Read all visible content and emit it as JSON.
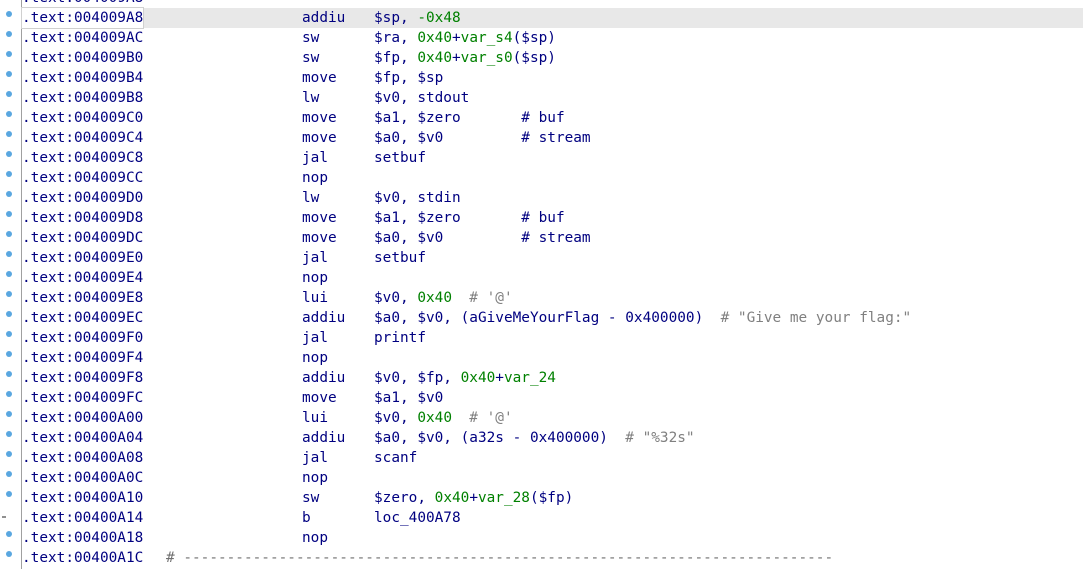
{
  "listing": {
    "partial_top_row": ".text:004009A8",
    "separator_comment": "# ---------------------------------------------------------------------------",
    "rows": [
      {
        "addr": ".text:004009A8",
        "mnem": "addiu",
        "ops": [
          {
            "t": "$sp, ",
            "c": "op"
          },
          {
            "t": "-0x48",
            "c": "num"
          }
        ],
        "selected": true
      },
      {
        "addr": ".text:004009AC",
        "mnem": "sw",
        "ops": [
          {
            "t": "$ra, ",
            "c": "op"
          },
          {
            "t": "0x40",
            "c": "num"
          },
          {
            "t": "+",
            "c": "op"
          },
          {
            "t": "var_s4",
            "c": "var"
          },
          {
            "t": "($sp)",
            "c": "op"
          }
        ]
      },
      {
        "addr": ".text:004009B0",
        "mnem": "sw",
        "ops": [
          {
            "t": "$fp, ",
            "c": "op"
          },
          {
            "t": "0x40",
            "c": "num"
          },
          {
            "t": "+",
            "c": "op"
          },
          {
            "t": "var_s0",
            "c": "var"
          },
          {
            "t": "($sp)",
            "c": "op"
          }
        ]
      },
      {
        "addr": ".text:004009B4",
        "mnem": "move",
        "ops": [
          {
            "t": "$fp, $sp",
            "c": "op"
          }
        ]
      },
      {
        "addr": ".text:004009B8",
        "mnem": "lw",
        "ops": [
          {
            "t": "$v0, stdout",
            "c": "op"
          }
        ]
      },
      {
        "addr": ".text:004009C0",
        "mnem": "move",
        "ops": [
          {
            "t": "$a1, $zero       # buf",
            "c": "op"
          }
        ]
      },
      {
        "addr": ".text:004009C4",
        "mnem": "move",
        "ops": [
          {
            "t": "$a0, $v0         # stream",
            "c": "op"
          }
        ]
      },
      {
        "addr": ".text:004009C8",
        "mnem": "jal",
        "ops": [
          {
            "t": "setbuf",
            "c": "op"
          }
        ]
      },
      {
        "addr": ".text:004009CC",
        "mnem": "nop",
        "ops": []
      },
      {
        "addr": ".text:004009D0",
        "mnem": "lw",
        "ops": [
          {
            "t": "$v0, stdin",
            "c": "op"
          }
        ]
      },
      {
        "addr": ".text:004009D8",
        "mnem": "move",
        "ops": [
          {
            "t": "$a1, $zero       # buf",
            "c": "op"
          }
        ]
      },
      {
        "addr": ".text:004009DC",
        "mnem": "move",
        "ops": [
          {
            "t": "$a0, $v0         # stream",
            "c": "op"
          }
        ]
      },
      {
        "addr": ".text:004009E0",
        "mnem": "jal",
        "ops": [
          {
            "t": "setbuf",
            "c": "op"
          }
        ]
      },
      {
        "addr": ".text:004009E4",
        "mnem": "nop",
        "ops": []
      },
      {
        "addr": ".text:004009E8",
        "mnem": "lui",
        "ops": [
          {
            "t": "$v0, ",
            "c": "op"
          },
          {
            "t": "0x40",
            "c": "num"
          },
          {
            "t": "  # '@'",
            "c": "cmt"
          }
        ]
      },
      {
        "addr": ".text:004009EC",
        "mnem": "addiu",
        "ops": [
          {
            "t": "$a0, $v0, (aGiveMeYourFlag - ",
            "c": "op"
          },
          {
            "t": "0x400000",
            "c": "op"
          },
          {
            "t": ")  ",
            "c": "op"
          },
          {
            "t": "# \"Give me your flag:\"",
            "c": "cmt"
          }
        ]
      },
      {
        "addr": ".text:004009F0",
        "mnem": "jal",
        "ops": [
          {
            "t": "printf",
            "c": "op"
          }
        ]
      },
      {
        "addr": ".text:004009F4",
        "mnem": "nop",
        "ops": []
      },
      {
        "addr": ".text:004009F8",
        "mnem": "addiu",
        "ops": [
          {
            "t": "$v0, $fp, ",
            "c": "op"
          },
          {
            "t": "0x40",
            "c": "num"
          },
          {
            "t": "+",
            "c": "op"
          },
          {
            "t": "var_24",
            "c": "var"
          }
        ]
      },
      {
        "addr": ".text:004009FC",
        "mnem": "move",
        "ops": [
          {
            "t": "$a1, $v0",
            "c": "op"
          }
        ]
      },
      {
        "addr": ".text:00400A00",
        "mnem": "lui",
        "ops": [
          {
            "t": "$v0, ",
            "c": "op"
          },
          {
            "t": "0x40",
            "c": "num"
          },
          {
            "t": "  # '@'",
            "c": "cmt"
          }
        ]
      },
      {
        "addr": ".text:00400A04",
        "mnem": "addiu",
        "ops": [
          {
            "t": "$a0, $v0, (a32s - ",
            "c": "op"
          },
          {
            "t": "0x400000",
            "c": "op"
          },
          {
            "t": ")  ",
            "c": "op"
          },
          {
            "t": "# \"%32s\"",
            "c": "cmt"
          }
        ]
      },
      {
        "addr": ".text:00400A08",
        "mnem": "jal",
        "ops": [
          {
            "t": "scanf",
            "c": "op"
          }
        ]
      },
      {
        "addr": ".text:00400A0C",
        "mnem": "nop",
        "ops": []
      },
      {
        "addr": ".text:00400A10",
        "mnem": "sw",
        "ops": [
          {
            "t": "$zero, ",
            "c": "op"
          },
          {
            "t": "0x40",
            "c": "num"
          },
          {
            "t": "+",
            "c": "op"
          },
          {
            "t": "var_28",
            "c": "var"
          },
          {
            "t": "($fp)",
            "c": "op"
          }
        ]
      },
      {
        "addr": ".text:00400A14",
        "mnem": "b",
        "ops": [
          {
            "t": "loc_400A78",
            "c": "op"
          }
        ],
        "dash_marker": true
      },
      {
        "addr": ".text:00400A18",
        "mnem": "nop",
        "ops": []
      },
      {
        "addr": ".text:00400A1C",
        "mnem": "",
        "ops": [],
        "separator": true
      }
    ]
  },
  "colors": {
    "text": "#000080",
    "number": "#008000",
    "variable": "#008000",
    "comment": "#808080",
    "selected_row": "#e8e8e8",
    "gutter_dot": "#5aa7e0"
  },
  "icons": {
    "gutter_marker": "breakpoint-dot-icon"
  }
}
